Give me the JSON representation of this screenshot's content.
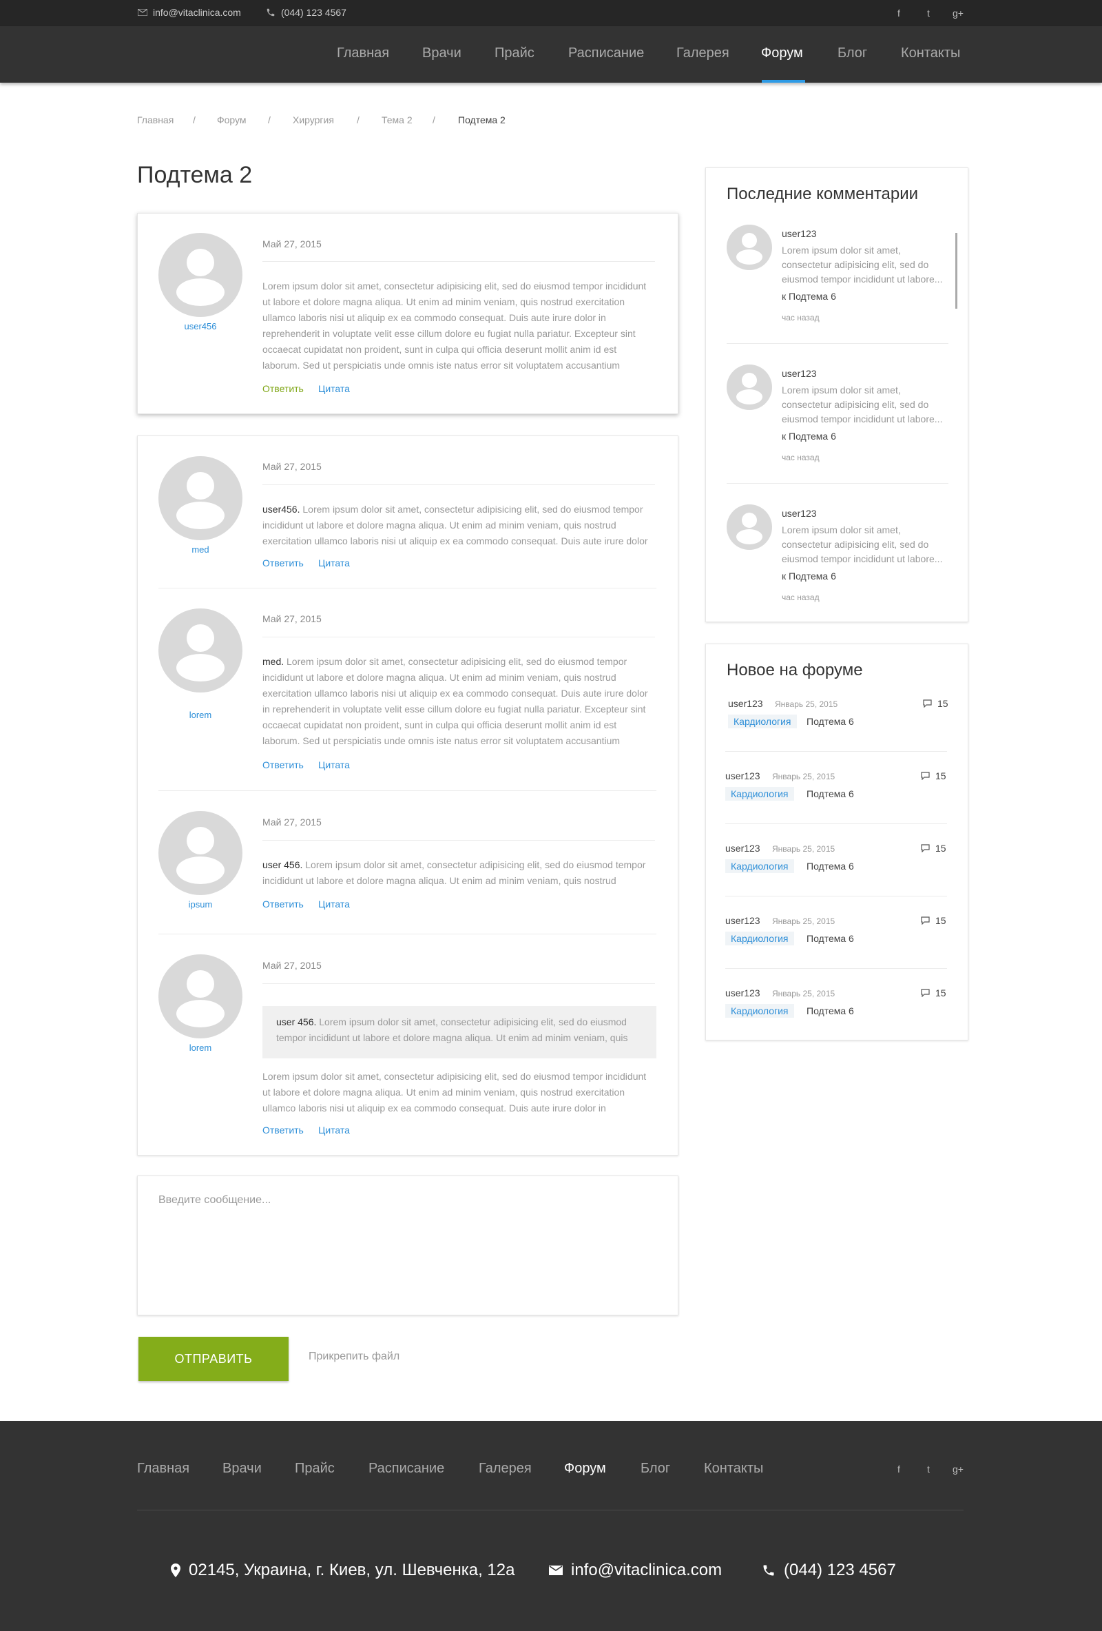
{
  "topbar": {
    "email": "info@vitaclinica.com",
    "phone": "(044) 123 4567",
    "social": [
      "f",
      "t",
      "g+"
    ]
  },
  "nav": {
    "items": [
      "Главная",
      "Врачи",
      "Прайс",
      "Расписание",
      "Галерея",
      "Форум",
      "Блог",
      "Контакты"
    ],
    "active": "Форум"
  },
  "breadcrumb": {
    "items": [
      "Главная",
      "Форум",
      "Хирургия",
      "Тема 2",
      "Подтема 2"
    ],
    "separator": "/"
  },
  "page_title": "Подтема 2",
  "posts": [
    {
      "user": "user456",
      "date": "Май 27, 2015",
      "text": "Lorem ipsum dolor sit amet, consectetur adipisicing elit, sed do eiusmod tempor incididunt ut labore et dolore magna aliqua. Ut enim ad minim veniam, quis nostrud exercitation ullamco laboris nisi ut aliquip ex ea commodo consequat. Duis aute irure dolor in reprehenderit in voluptate velit esse cillum dolore eu fugiat nulla pariatur. Excepteur sint occaecat cupidatat non proident, sunt in culpa qui officia deserunt mollit anim id est laborum. Sed ut perspiciatis unde omnis iste natus error sit voluptatem accusantium",
      "reply_label": "Ответить",
      "quote_label": "Цитата"
    },
    {
      "user": "med",
      "date": "Май 27, 2015",
      "mention": "user456.",
      "text": "Lorem ipsum dolor sit amet, consectetur adipisicing elit, sed do eiusmod tempor incididunt ut labore et dolore magna aliqua. Ut enim ad minim veniam, quis nostrud exercitation ullamco laboris nisi ut aliquip ex ea commodo consequat. Duis aute irure dolor",
      "reply_label": "Ответить",
      "quote_label": "Цитата"
    },
    {
      "user": "lorem",
      "date": "Май 27, 2015",
      "mention": "med.",
      "text": "Lorem ipsum dolor sit amet, consectetur adipisicing elit, sed do eiusmod tempor incididunt ut labore et dolore magna aliqua. Ut enim ad minim veniam, quis nostrud exercitation ullamco laboris nisi ut aliquip ex ea commodo consequat. Duis aute irure dolor in reprehenderit in voluptate velit esse cillum dolore eu fugiat nulla pariatur. Excepteur sint occaecat cupidatat non proident, sunt in culpa qui officia deserunt mollit anim id est laborum. Sed ut perspiciatis unde omnis iste natus error sit voluptatem accusantium",
      "reply_label": "Ответить",
      "quote_label": "Цитата"
    },
    {
      "user": "ipsum",
      "date": "Май 27, 2015",
      "mention": "user 456.",
      "text": "Lorem ipsum dolor sit amet, consectetur adipisicing elit, sed do eiusmod tempor incididunt ut labore et dolore magna aliqua. Ut enim ad minim veniam, quis nostrud",
      "reply_label": "Ответить",
      "quote_label": "Цитата"
    },
    {
      "user": "lorem",
      "date": "Май 27, 2015",
      "quote_mention": "user 456.",
      "quote_text": "Lorem ipsum dolor sit amet, consectetur adipisicing elit, sed do eiusmod tempor incididunt ut labore et dolore magna aliqua. Ut enim ad minim veniam, quis",
      "text": "Lorem ipsum dolor sit amet, consectetur adipisicing elit, sed do eiusmod tempor incididunt ut labore et dolore magna aliqua. Ut enim ad minim veniam, quis nostrud exercitation ullamco laboris nisi ut aliquip ex ea commodo consequat. Duis aute irure dolor in",
      "reply_label": "Ответить",
      "quote_label": "Цитата"
    }
  ],
  "composer": {
    "placeholder": "Введите сообщение...",
    "send_label": "ОТПРАВИТЬ",
    "attach_label": "Прикрепить файл"
  },
  "recent_comments": {
    "title": "Последние комментарии",
    "items": [
      {
        "user": "user123",
        "text": "Lorem ipsum dolor sit amet, consectetur adipisicing elit, sed do eiusmod tempor incididunt ut labore...",
        "to": "к Подтема 6",
        "time": "час назад"
      },
      {
        "user": "user123",
        "text": "Lorem ipsum dolor sit amet, consectetur adipisicing elit, sed do eiusmod tempor incididunt ut labore...",
        "to": "к Подтема 6",
        "time": "час назад"
      },
      {
        "user": "user123",
        "text": "Lorem ipsum dolor sit amet, consectetur adipisicing elit, sed do eiusmod tempor incididunt ut labore...",
        "to": "к Подтема 6",
        "time": "час назад"
      }
    ]
  },
  "new_on_forum": {
    "title": "Новое на форуме",
    "items": [
      {
        "user": "user123",
        "date": "Январь 25, 2015",
        "count": "15",
        "tag": "Кардиология",
        "topic": "Подтема 6"
      },
      {
        "user": "user123",
        "date": "Январь 25, 2015",
        "count": "15",
        "tag": "Кардиология",
        "topic": "Подтема 6"
      },
      {
        "user": "user123",
        "date": "Январь 25, 2015",
        "count": "15",
        "tag": "Кардиология",
        "topic": "Подтема 6"
      },
      {
        "user": "user123",
        "date": "Январь 25, 2015",
        "count": "15",
        "tag": "Кардиология",
        "topic": "Подтема 6"
      },
      {
        "user": "user123",
        "date": "Январь 25, 2015",
        "count": "15",
        "tag": "Кардиология",
        "topic": "Подтема 6"
      }
    ]
  },
  "footer": {
    "nav": [
      "Главная",
      "Врачи",
      "Прайс",
      "Расписание",
      "Галерея",
      "Форум",
      "Блог",
      "Контакты"
    ],
    "address": "02145, Украина, г. Киев, ул. Шевченка, 12а",
    "email": "info@vitaclinica.com",
    "phone": "(044) 123 4567"
  },
  "colors": {
    "accent_blue": "#2e9be6",
    "send_green": "#84ad1a",
    "dark_bg": "#333333"
  },
  "icons": [
    "mail-icon",
    "phone-icon",
    "facebook-icon",
    "twitter-icon",
    "google-plus-icon",
    "comment-icon",
    "map-pin-icon"
  ]
}
